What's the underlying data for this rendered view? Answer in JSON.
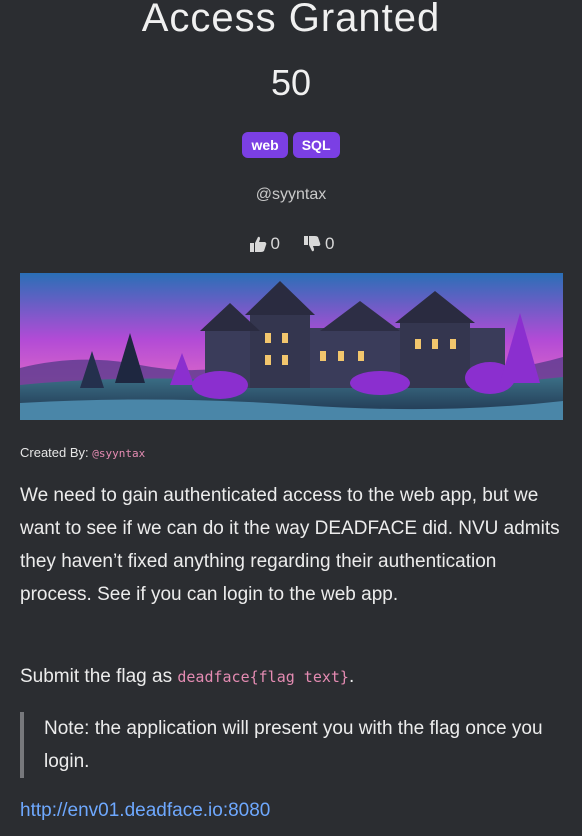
{
  "challenge": {
    "title": "Access Granted",
    "points": "50",
    "tags": [
      "web",
      "SQL"
    ],
    "author": "@syyntax",
    "upvotes": "0",
    "downvotes": "0"
  },
  "banner": {
    "icon": "haunted-mansion-illustration",
    "colors": {
      "sky_top": "#2a6fb6",
      "sky_mid": "#b24bd6",
      "sky_low": "#e26bc6",
      "ground": "#3b6f86",
      "mansion": "#3a3c5a",
      "trees": "#8b2fcf"
    }
  },
  "created_by": {
    "label": "Created By:",
    "handle": "@syyntax"
  },
  "description": {
    "text": "We need to gain authenticated access to the web app, but we want to see if we can do it the way DEADFACE did. NVU admits they haven’t fixed anything regarding their authentication process. See if you can login to the web app."
  },
  "submit": {
    "prefix": "Submit the flag as ",
    "format": "deadface{flag text}",
    "suffix": "."
  },
  "note": {
    "text": "Note: the application will present you with the flag once you login."
  },
  "link": {
    "url": "http://env01.deadface.io:8080"
  },
  "colors": {
    "background": "#2b2d31",
    "tag": "#7b3fe4",
    "link": "#6ea8fe",
    "code": "#e48bb2"
  }
}
